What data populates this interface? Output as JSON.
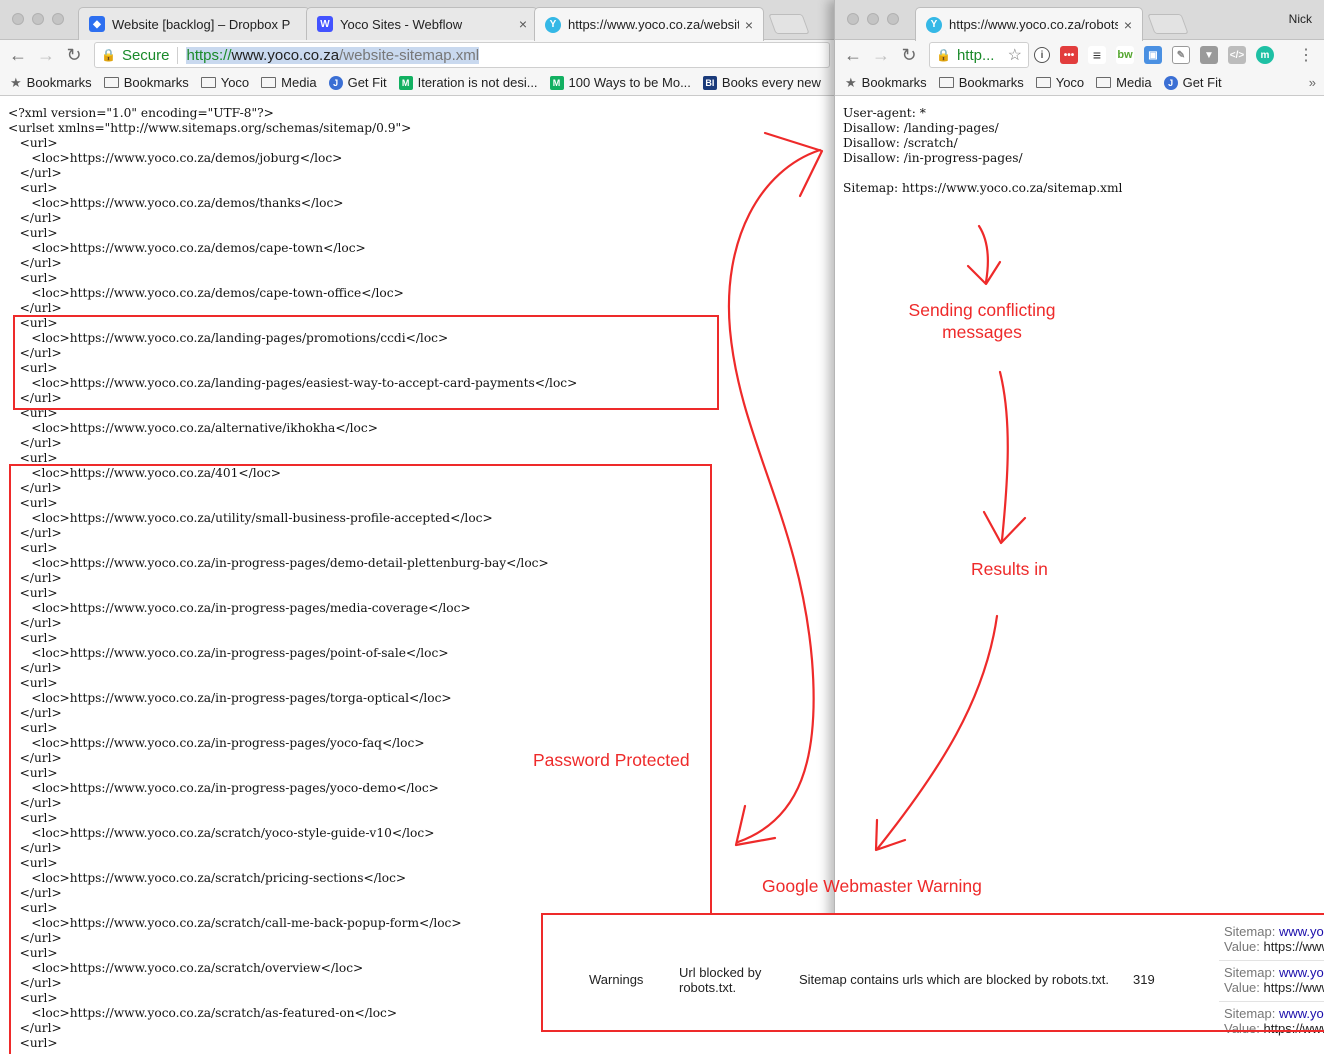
{
  "left_window": {
    "tabs": [
      {
        "title": "Website [backlog] – Dropbox P",
        "favicon": "dropbox-icon",
        "color": "#2d6ff0"
      },
      {
        "title": "Yoco Sites - Webflow",
        "favicon": "webflow-icon",
        "color": "#4353ff"
      },
      {
        "title": "https://www.yoco.co.za/websit",
        "favicon": "yoco-icon",
        "color": "#35b8e6"
      }
    ],
    "secure_label": "Secure",
    "url_scheme": "https://",
    "url_host": "www.yoco.co.za",
    "url_path": "/website-sitemap.xml",
    "bookmarks": [
      {
        "label": "Bookmarks",
        "icon": "star-icon"
      },
      {
        "label": "Bookmarks",
        "icon": "folder-icon"
      },
      {
        "label": "Yoco",
        "icon": "folder-icon"
      },
      {
        "label": "Media",
        "icon": "folder-icon"
      },
      {
        "label": "Get Fit",
        "icon": "j-icon"
      },
      {
        "label": "Iteration is not desi...",
        "icon": "medium-icon"
      },
      {
        "label": "100 Ways to be Mo...",
        "icon": "medium-icon"
      },
      {
        "label": "Books every new",
        "icon": "bi-icon"
      }
    ],
    "xml_lines": [
      "<?xml version=\"1.0\" encoding=\"UTF-8\"?>",
      "<urlset xmlns=\"http://www.sitemaps.org/schemas/sitemap/0.9\">",
      "   <url>",
      "      <loc>https://www.yoco.co.za/demos/joburg</loc>",
      "   </url>",
      "   <url>",
      "      <loc>https://www.yoco.co.za/demos/thanks</loc>",
      "   </url>",
      "   <url>",
      "      <loc>https://www.yoco.co.za/demos/cape-town</loc>",
      "   </url>",
      "   <url>",
      "      <loc>https://www.yoco.co.za/demos/cape-town-office</loc>",
      "   </url>",
      "   <url>",
      "      <loc>https://www.yoco.co.za/landing-pages/promotions/ccdi</loc>",
      "   </url>",
      "   <url>",
      "      <loc>https://www.yoco.co.za/landing-pages/easiest-way-to-accept-card-payments</loc>",
      "   </url>",
      "   <url>",
      "      <loc>https://www.yoco.co.za/alternative/ikhokha</loc>",
      "   </url>",
      "   <url>",
      "      <loc>https://www.yoco.co.za/401</loc>",
      "   </url>",
      "   <url>",
      "      <loc>https://www.yoco.co.za/utility/small-business-profile-accepted</loc>",
      "   </url>",
      "   <url>",
      "      <loc>https://www.yoco.co.za/in-progress-pages/demo-detail-plettenburg-bay</loc>",
      "   </url>",
      "   <url>",
      "      <loc>https://www.yoco.co.za/in-progress-pages/media-coverage</loc>",
      "   </url>",
      "   <url>",
      "      <loc>https://www.yoco.co.za/in-progress-pages/point-of-sale</loc>",
      "   </url>",
      "   <url>",
      "      <loc>https://www.yoco.co.za/in-progress-pages/torga-optical</loc>",
      "   </url>",
      "   <url>",
      "      <loc>https://www.yoco.co.za/in-progress-pages/yoco-faq</loc>",
      "   </url>",
      "   <url>",
      "      <loc>https://www.yoco.co.za/in-progress-pages/yoco-demo</loc>",
      "   </url>",
      "   <url>",
      "      <loc>https://www.yoco.co.za/scratch/yoco-style-guide-v10</loc>",
      "   </url>",
      "   <url>",
      "      <loc>https://www.yoco.co.za/scratch/pricing-sections</loc>",
      "   </url>",
      "   <url>",
      "      <loc>https://www.yoco.co.za/scratch/call-me-back-popup-form</loc>",
      "   </url>",
      "   <url>",
      "      <loc>https://www.yoco.co.za/scratch/overview</loc>",
      "   </url>",
      "   <url>",
      "      <loc>https://www.yoco.co.za/scratch/as-featured-on</loc>",
      "   </url>",
      "   <url>"
    ]
  },
  "right_window": {
    "tab_title": "https://www.yoco.co.za/robots",
    "user_name": "Nick",
    "omnibox_text": "http...",
    "bookmarks": [
      {
        "label": "Bookmarks",
        "icon": "star-icon"
      },
      {
        "label": "Bookmarks",
        "icon": "folder-icon"
      },
      {
        "label": "Yoco",
        "icon": "folder-icon"
      },
      {
        "label": "Media",
        "icon": "folder-icon"
      },
      {
        "label": "Get Fit",
        "icon": "j-icon"
      }
    ],
    "more_label": "»",
    "robots_lines": [
      "User-agent: *",
      "Disallow: /landing-pages/",
      "Disallow: /scratch/",
      "Disallow: /in-progress-pages/",
      "",
      "Sitemap: https://www.yoco.co.za/sitemap.xml"
    ]
  },
  "annotations": {
    "password_protected": "Password Protected",
    "sending_conflicting": "Sending conflicting\nmessages",
    "results_in": "Results in",
    "google_webmaster_warning": "Google Webmaster Warning",
    "color": "#ee2a2a"
  },
  "warning_panel": {
    "type_label": "Warnings",
    "issue": "Url blocked by\nrobots.txt.",
    "description": "Sitemap contains urls which are blocked by robots.txt.",
    "count": "319",
    "side_entries": [
      {
        "sitemap_label": "Sitemap:",
        "sitemap_link": "www.yo",
        "value_label": "Value:",
        "value_text": "https://www"
      },
      {
        "sitemap_label": "Sitemap:",
        "sitemap_link": "www.yo",
        "value_label": "Value:",
        "value_text": "https://www"
      },
      {
        "sitemap_label": "Sitemap:",
        "sitemap_link": "www.yo",
        "value_label": "Value:",
        "value_text": "https://www"
      }
    ]
  }
}
